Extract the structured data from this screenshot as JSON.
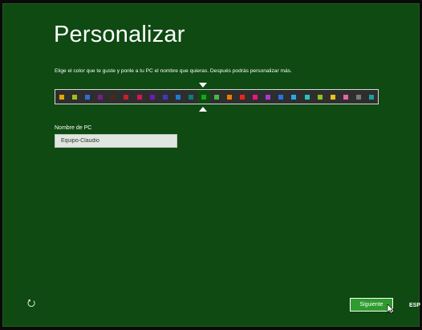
{
  "header": {
    "title": "Personalizar",
    "subtitle": "Elige el color que te guste y ponle a tu PC el nombre que quieras. Después podrás personalizar más."
  },
  "palette": {
    "colors": [
      "#e0a800",
      "#9fbf1f",
      "#2f6fd0",
      "#7a1e8a",
      "#4a2a1a",
      "#c8202a",
      "#d4145a",
      "#6d1bb0",
      "#3a3ac0",
      "#1e7bd6",
      "#0a7d7d",
      "#1fa01f",
      "#3fbf3f",
      "#f07a00",
      "#e8271a",
      "#e8197d",
      "#a53bd6",
      "#2673e8",
      "#2aa9e8",
      "#2cc2b5",
      "#8cc41c",
      "#e8c21a",
      "#e865a8",
      "#7a7a7a",
      "#1aa0a0"
    ],
    "selected_index": 11,
    "colors_meaning": "swatch colors"
  },
  "pc_name": {
    "label": "Nombre de PC",
    "value": "Equipo-Claudio"
  },
  "footer": {
    "next_label": "Siguiente",
    "language": "ESP",
    "accessibility_icon": "ease-of-access-icon",
    "accessibility_glyph": "⭮"
  },
  "theme": {
    "background": "#0e4a12",
    "button": "#2e9b2e"
  }
}
